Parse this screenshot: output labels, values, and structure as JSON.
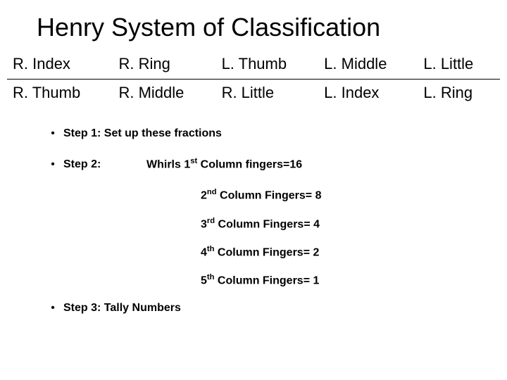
{
  "title": "Henry System of Classification",
  "table": {
    "top": [
      "R. Index",
      "R. Ring",
      "L. Thumb",
      "L. Middle",
      "L. Little"
    ],
    "bottom": [
      "R. Thumb",
      "R. Middle",
      "R. Little",
      "L. Index",
      "L. Ring"
    ]
  },
  "steps": {
    "step1": "Step 1: Set up these fractions",
    "step2_label": "Step 2:",
    "step2_first_pre": "Whirls 1",
    "step2_first_sup": "st",
    "step2_first_post": " Column fingers=16",
    "columns": [
      {
        "pre": "2",
        "sup": "nd",
        "post": " Column Fingers= 8"
      },
      {
        "pre": "3",
        "sup": "rd",
        "post": " Column Fingers= 4"
      },
      {
        "pre": "4",
        "sup": "th",
        "post": " Column Fingers= 2"
      },
      {
        "pre": "5",
        "sup": "th",
        "post": " Column Fingers= 1"
      }
    ],
    "step3": "Step 3: Tally Numbers"
  }
}
